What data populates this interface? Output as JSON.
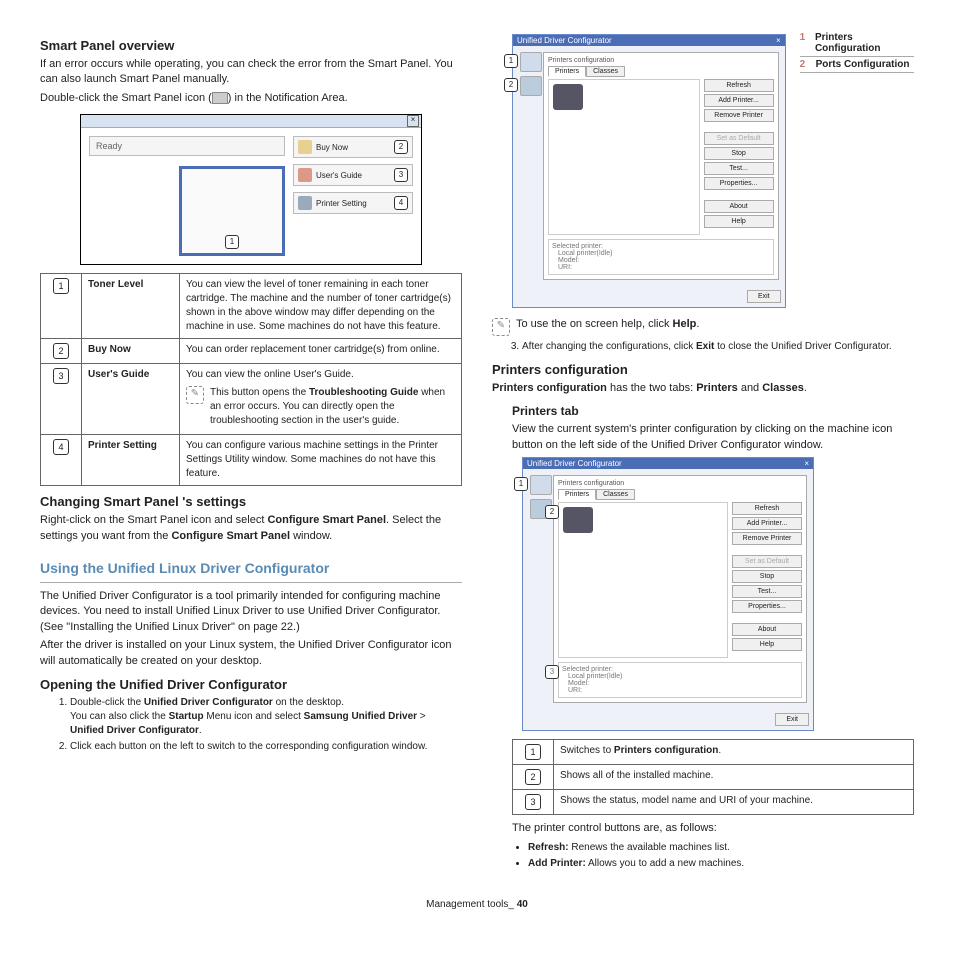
{
  "left": {
    "h_smart": "Smart Panel overview",
    "p_smart1": "If an error occurs while operating, you can check the error from the Smart Panel. You can also launch Smart Panel manually.",
    "p_smart2a": "Double-click the Smart Panel icon (",
    "p_smart2b": ") in the Notification Area.",
    "sp": {
      "ready": "Ready",
      "buy": "Buy Now",
      "guide": "User's Guide",
      "setting": "Printer Setting",
      "c1": "1",
      "c2": "2",
      "c3": "3",
      "c4": "4"
    },
    "tbl": {
      "r1": {
        "n": "1",
        "t": "Toner Level",
        "d": "You can view the level of toner remaining in each toner cartridge. The machine and the number of toner cartridge(s) shown in the above window may differ depending on the machine in use. Some machines do not have this feature."
      },
      "r2": {
        "n": "2",
        "t": "Buy Now",
        "d": "You can order replacement toner cartridge(s) from online."
      },
      "r3": {
        "n": "3",
        "t": "User's Guide",
        "d": "You can view the online User's Guide.",
        "note": "This button opens the Troubleshooting Guide when an error occurs. You can directly open the troubleshooting section in the user's guide.",
        "nb": "Troubleshooting Guide"
      },
      "r4": {
        "n": "4",
        "t": "Printer Setting",
        "d": "You can configure various machine settings in the Printer Settings Utility window. Some machines do not have this feature."
      }
    },
    "h_change": "Changing Smart Panel 's settings",
    "p_change1a": "Right-click on the Smart Panel icon and select ",
    "p_change1b": "Configure Smart Panel",
    "p_change1c": ". Select the settings you want from the ",
    "p_change1d": "Configure Smart Panel",
    "p_change1e": " window.",
    "h_using": "Using the Unified Linux Driver Configurator",
    "p_using1": "The Unified Driver Configurator is a tool primarily intended for configuring machine devices. You need to install Unified Linux Driver to use Unified Driver Configurator. (See \"Installing the Unified Linux Driver\" on page 22.)",
    "p_using2": "After the driver is installed on your Linux system, the Unified Driver Configurator icon will automatically be created on your desktop.",
    "h_open": "Opening the Unified Driver Configurator",
    "ol1": {
      "a": "Double-click the ",
      "ab": "Unified Driver Configurator",
      "ac": " on the desktop.",
      "b": "You can also click the ",
      "bb": "Startup",
      "bc": " Menu icon and select ",
      "bd": "Samsung Unified Driver",
      "be": " > ",
      "bf": "Unified Driver Configurator",
      "bg": "."
    },
    "ol2": "Click each button on the left to switch to the corresponding configuration window."
  },
  "right": {
    "uw": {
      "title": "Unified Driver Configurator",
      "fieldset": "Printers configuration",
      "tab1": "Printers",
      "tab2": "Classes",
      "refresh": "Refresh",
      "add": "Add Printer...",
      "remove": "Remove Printer",
      "setdef": "Set as Default",
      "stop": "Stop",
      "test": "Test...",
      "props": "Properties...",
      "about": "About",
      "help": "Help",
      "sel": "Selected printer:",
      "local": "Local printer(Idle)",
      "model": "Model:",
      "uri": "URI:",
      "exit": "Exit",
      "c1": "1",
      "c2": "2",
      "c3": "3"
    },
    "legend1": {
      "n1": "1",
      "t1": "Printers Configuration",
      "n2": "2",
      "t2": "Ports Configuration"
    },
    "note_help_a": "To use the on screen help, click ",
    "note_help_b": "Help",
    "note_help_c": ".",
    "ol3a": "After changing the configurations, click ",
    "ol3b": "Exit",
    "ol3c": " to close the Unified Driver Configurator.",
    "h_printers": "Printers configuration",
    "p_printers_a": "Printers configuration",
    "p_printers_b": " has the two tabs: ",
    "p_printers_c": "Printers",
    "p_printers_d": " and ",
    "p_printers_e": "Classes",
    "p_printers_f": ".",
    "h_ptab": "Printers tab",
    "p_ptab": "View the current system's printer configuration by clicking on the machine icon button on the left side of the Unified Driver Configurator window.",
    "tbl2": {
      "r1": {
        "n": "1",
        "a": "Switches to ",
        "b": "Printers configuration",
        "c": "."
      },
      "r2": {
        "n": "2",
        "d": "Shows all of the installed machine."
      },
      "r3": {
        "n": "3",
        "d": "Shows the status, model name and URI of your machine."
      }
    },
    "p_ctrl": "The printer control buttons are, as follows:",
    "b1a": "Refresh:",
    "b1b": " Renews the available machines list.",
    "b2a": "Add Printer:",
    "b2b": " Allows you to add a new machines."
  },
  "footer": {
    "label": "Management tools",
    "sep": "_ ",
    "page": "40"
  }
}
